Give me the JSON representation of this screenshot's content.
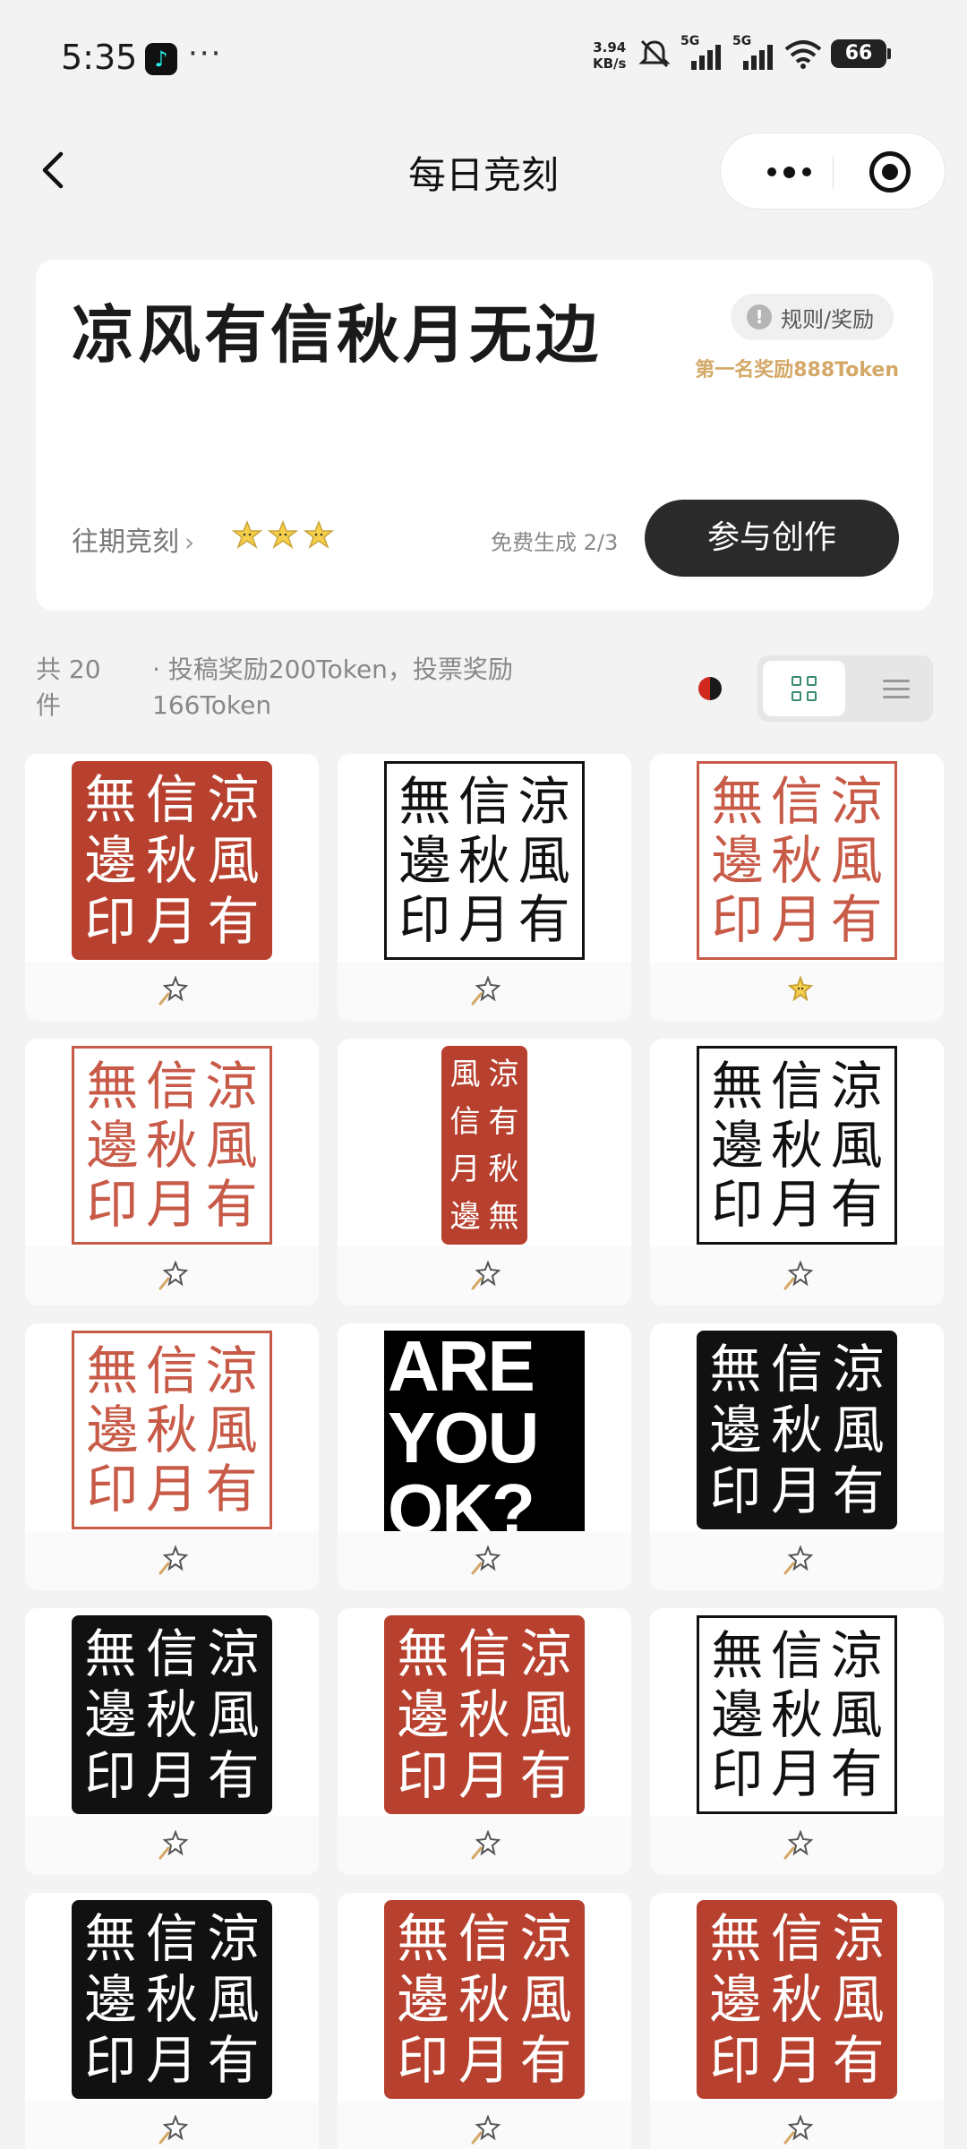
{
  "status_bar": {
    "time": "5:35",
    "more": "···",
    "net_speed_value": "3.94",
    "net_speed_unit": "KB/s",
    "signal_1": "5G",
    "signal_2": "5G",
    "battery": "66"
  },
  "nav": {
    "title": "每日竞刻"
  },
  "topic": {
    "title": "凉风有信秋月无边",
    "rules_label": "规则/奖励",
    "first_prize": "第一名奖励888Token",
    "history_label": "往期竞刻",
    "free_quota": "免费生成 2/3",
    "join_label": "参与创作"
  },
  "filter": {
    "count": "共 20 件",
    "bonus": "· 投稿奖励200Token，投票奖励166Token"
  },
  "seal_text": [
    "涼",
    "風",
    "有",
    "信",
    "秋",
    "月",
    "無",
    "邊",
    "印"
  ],
  "works": [
    {
      "style": "red",
      "starred": false
    },
    {
      "style": "outline-black",
      "starred": false
    },
    {
      "style": "outline-red",
      "starred": true
    },
    {
      "style": "outline-red",
      "starred": false
    },
    {
      "style": "thin-red",
      "starred": false
    },
    {
      "style": "outline-black",
      "starred": false
    },
    {
      "style": "outline-red",
      "starred": false
    },
    {
      "style": "are-you-ok",
      "lines": [
        "ARE",
        "YOU",
        "OK?"
      ],
      "starred": false
    },
    {
      "style": "black",
      "starred": false
    },
    {
      "style": "black",
      "starred": false
    },
    {
      "style": "red",
      "starred": false
    },
    {
      "style": "outline-black",
      "starred": false
    },
    {
      "style": "black",
      "starred": false
    },
    {
      "style": "red",
      "starred": false
    },
    {
      "style": "red",
      "starred": false
    }
  ],
  "colors": {
    "seal_red": "#b8402e",
    "prize_gold": "#d4a867",
    "accent_green": "#3a8a74",
    "star_yellow": "#f6cf4a"
  }
}
